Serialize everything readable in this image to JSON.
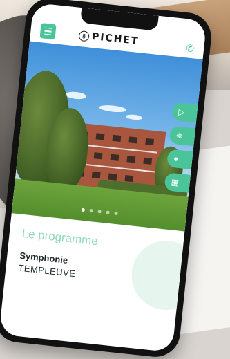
{
  "header": {
    "brand": "PICHET",
    "brand_mark": "§",
    "menu_icon": "hamburger-icon",
    "phone_icon": "phone-icon"
  },
  "carousel": {
    "slides": 5,
    "active_index": 0
  },
  "actions": [
    {
      "name": "video-button",
      "icon": "play-icon",
      "glyph": "▷"
    },
    {
      "name": "virtual-tour-button",
      "icon": "360-icon",
      "glyph": "✵"
    },
    {
      "name": "map-button",
      "icon": "location-pin-icon",
      "glyph": "●"
    },
    {
      "name": "plans-button",
      "icon": "floor-plan-icon",
      "glyph": "▦"
    }
  ],
  "program": {
    "section_title": "Le programme",
    "name": "Symphonie",
    "city": "TEMPLEUVE"
  },
  "colors": {
    "accent": "#4bc49a",
    "section_title": "#8fd9b8"
  }
}
